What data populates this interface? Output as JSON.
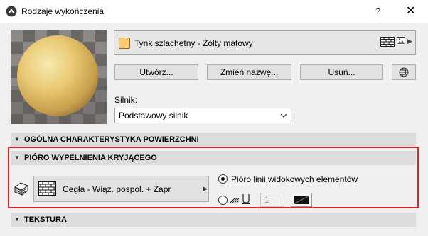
{
  "window": {
    "title": "Rodzaje wykończenia",
    "help_label": "?",
    "close_label": "✕"
  },
  "material": {
    "name": "Tynk szlachetny - Żółty matowy",
    "swatch_color": "#ffc875"
  },
  "buttons": {
    "create": "Utwórz...",
    "rename": "Zmień nazwę...",
    "delete": "Usuń..."
  },
  "engine": {
    "label": "Silnik:",
    "value": "Podstawowy silnik"
  },
  "sections": {
    "surface": "OGÓLNA CHARAKTERYSTYKA POWIERZCHNI",
    "cover_fill_pen": "PIÓRO WYPEŁNIENIA KRYJĄCEGO",
    "texture": "TEKSTURA"
  },
  "cover_fill": {
    "fill_name": "Cegła - Wiąz. pospol. + Zapr",
    "option_view_pen": "Pióro linii widokowych elementów",
    "pen_number": "1"
  },
  "colors": {
    "highlight": "#e02424",
    "sphere": "#e8c25a"
  }
}
